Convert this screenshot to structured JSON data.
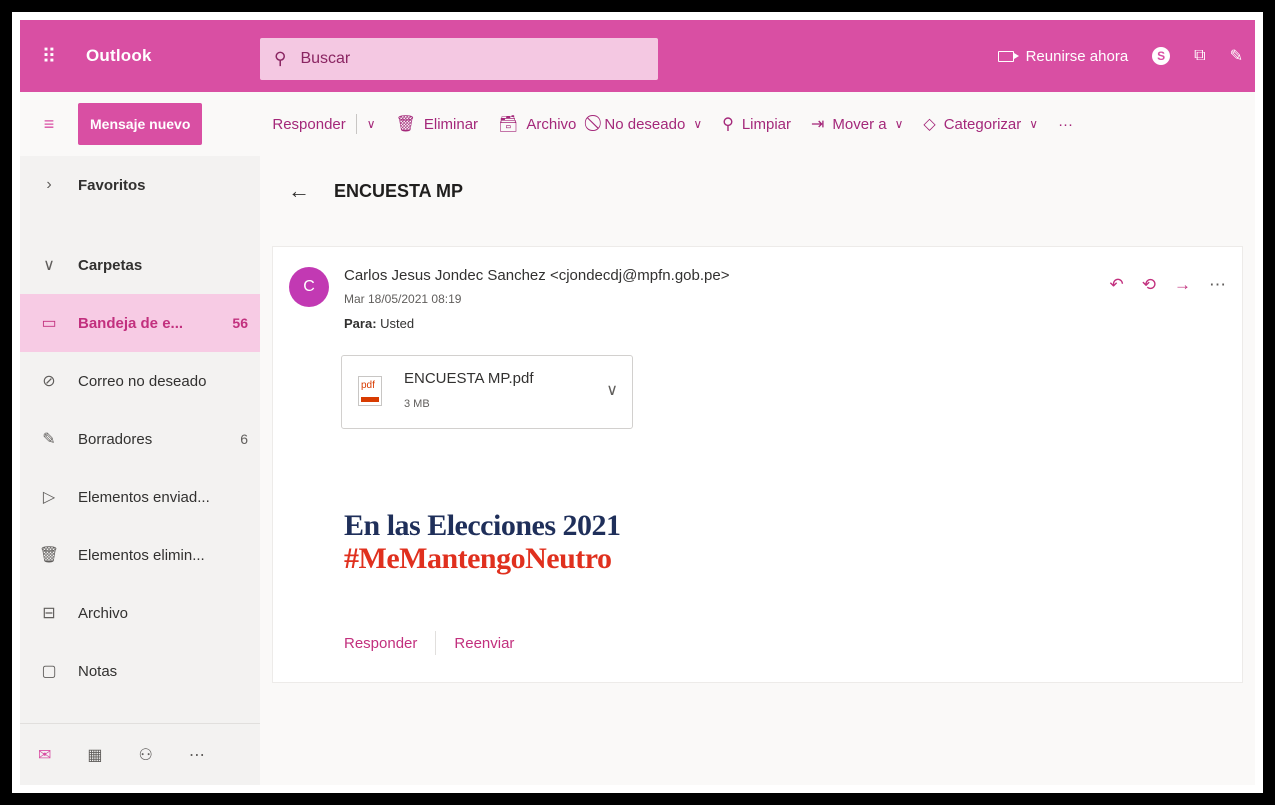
{
  "app": {
    "name": "Outlook"
  },
  "search": {
    "placeholder": "Buscar"
  },
  "topbar": {
    "meet_now": "Reunirse ahora"
  },
  "commands": {
    "new_message": "Mensaje nuevo",
    "reply": "Responder",
    "delete": "Eliminar",
    "archive": "Archivo",
    "junk": "No deseado",
    "sweep": "Limpiar",
    "move_to": "Mover a",
    "categorize": "Categorizar",
    "more": "···"
  },
  "nav": {
    "favorites": "Favoritos",
    "folders": "Carpetas",
    "items": [
      {
        "label": "Bandeja de e...",
        "count": "56"
      },
      {
        "label": "Correo no deseado",
        "count": ""
      },
      {
        "label": "Borradores",
        "count": "6"
      },
      {
        "label": "Elementos enviad...",
        "count": ""
      },
      {
        "label": "Elementos elimin...",
        "count": ""
      },
      {
        "label": "Archivo",
        "count": ""
      },
      {
        "label": "Notas",
        "count": ""
      }
    ]
  },
  "message": {
    "subject": "ENCUESTA MP",
    "avatar_initial": "C",
    "sender": "Carlos Jesus Jondec Sanchez <cjondecdj@mpfn.gob.pe>",
    "date": "Mar 18/05/2021 08:19",
    "to_label": "Para:",
    "to_value": "Usted",
    "attachment": {
      "name": "ENCUESTA MP.pdf",
      "size": "3 MB",
      "type_label": "pdf"
    },
    "banner_line1": "En las Elecciones 2021",
    "banner_line2": "#MeMantengoNeutro",
    "reply_link": "Responder",
    "forward_link": "Reenviar"
  },
  "colors": {
    "brand": "#d94fa3",
    "accent_text": "#c2307e",
    "selected_bg": "#f7cbe4",
    "banner_navy": "#1f2f5a",
    "banner_red": "#e0301e"
  }
}
